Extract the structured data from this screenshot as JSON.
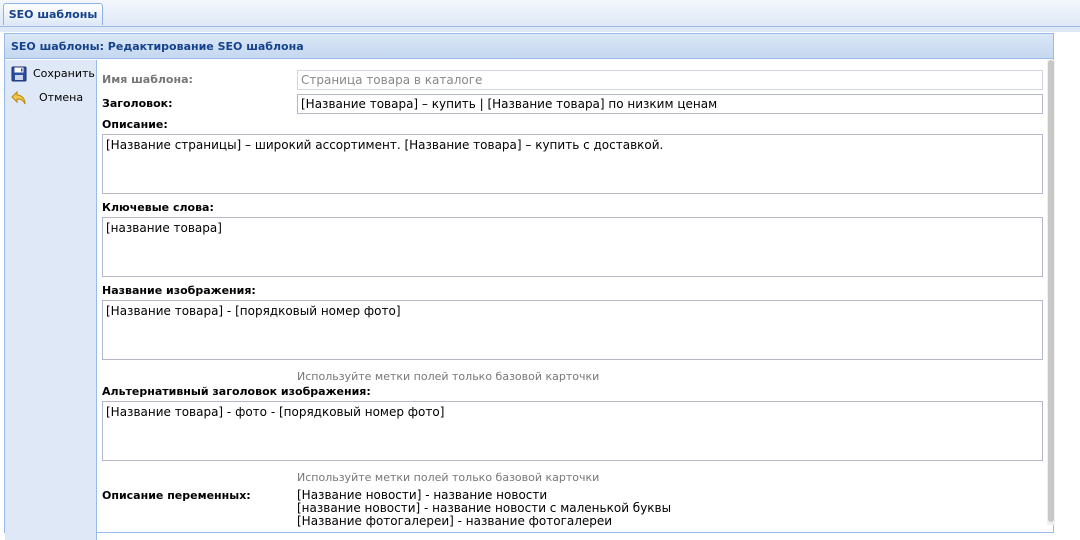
{
  "tabs": [
    {
      "label": "SEO шаблоны"
    }
  ],
  "panel": {
    "title": "SEO шаблоны: Редактирование SEO шаблона"
  },
  "toolbar": {
    "save_label": "Сохранить",
    "cancel_label": "Отмена"
  },
  "form": {
    "template_name": {
      "label": "Имя шаблона:",
      "value": "Страница товара в каталоге"
    },
    "heading": {
      "label": "Заголовок:",
      "value": "[Название товара] – купить | [Название товара] по низким ценам"
    },
    "description": {
      "label": "Описание:",
      "value": "[Название страницы] – широкий ассортимент. [Название товара] – купить с доставкой."
    },
    "keywords": {
      "label": "Ключевые слова:",
      "value": "[название товара]"
    },
    "image_name": {
      "label": "Название изображения:",
      "value": "[Название товара] - [порядковый номер фото]",
      "hint": "Используйте метки полей только базовой карточки"
    },
    "image_alt": {
      "label": "Альтернативный заголовок изображения:",
      "value": "[Название товара] - фото - [порядковый номер фото]",
      "hint": "Используйте метки полей только базовой карточки"
    },
    "variables": {
      "label": "Описание переменных:",
      "lines": [
        "[Название новости] - название новости",
        "[название новости] - название новости с маленькой буквы",
        "[Название фотогалереи] - название фотогалереи"
      ]
    }
  }
}
